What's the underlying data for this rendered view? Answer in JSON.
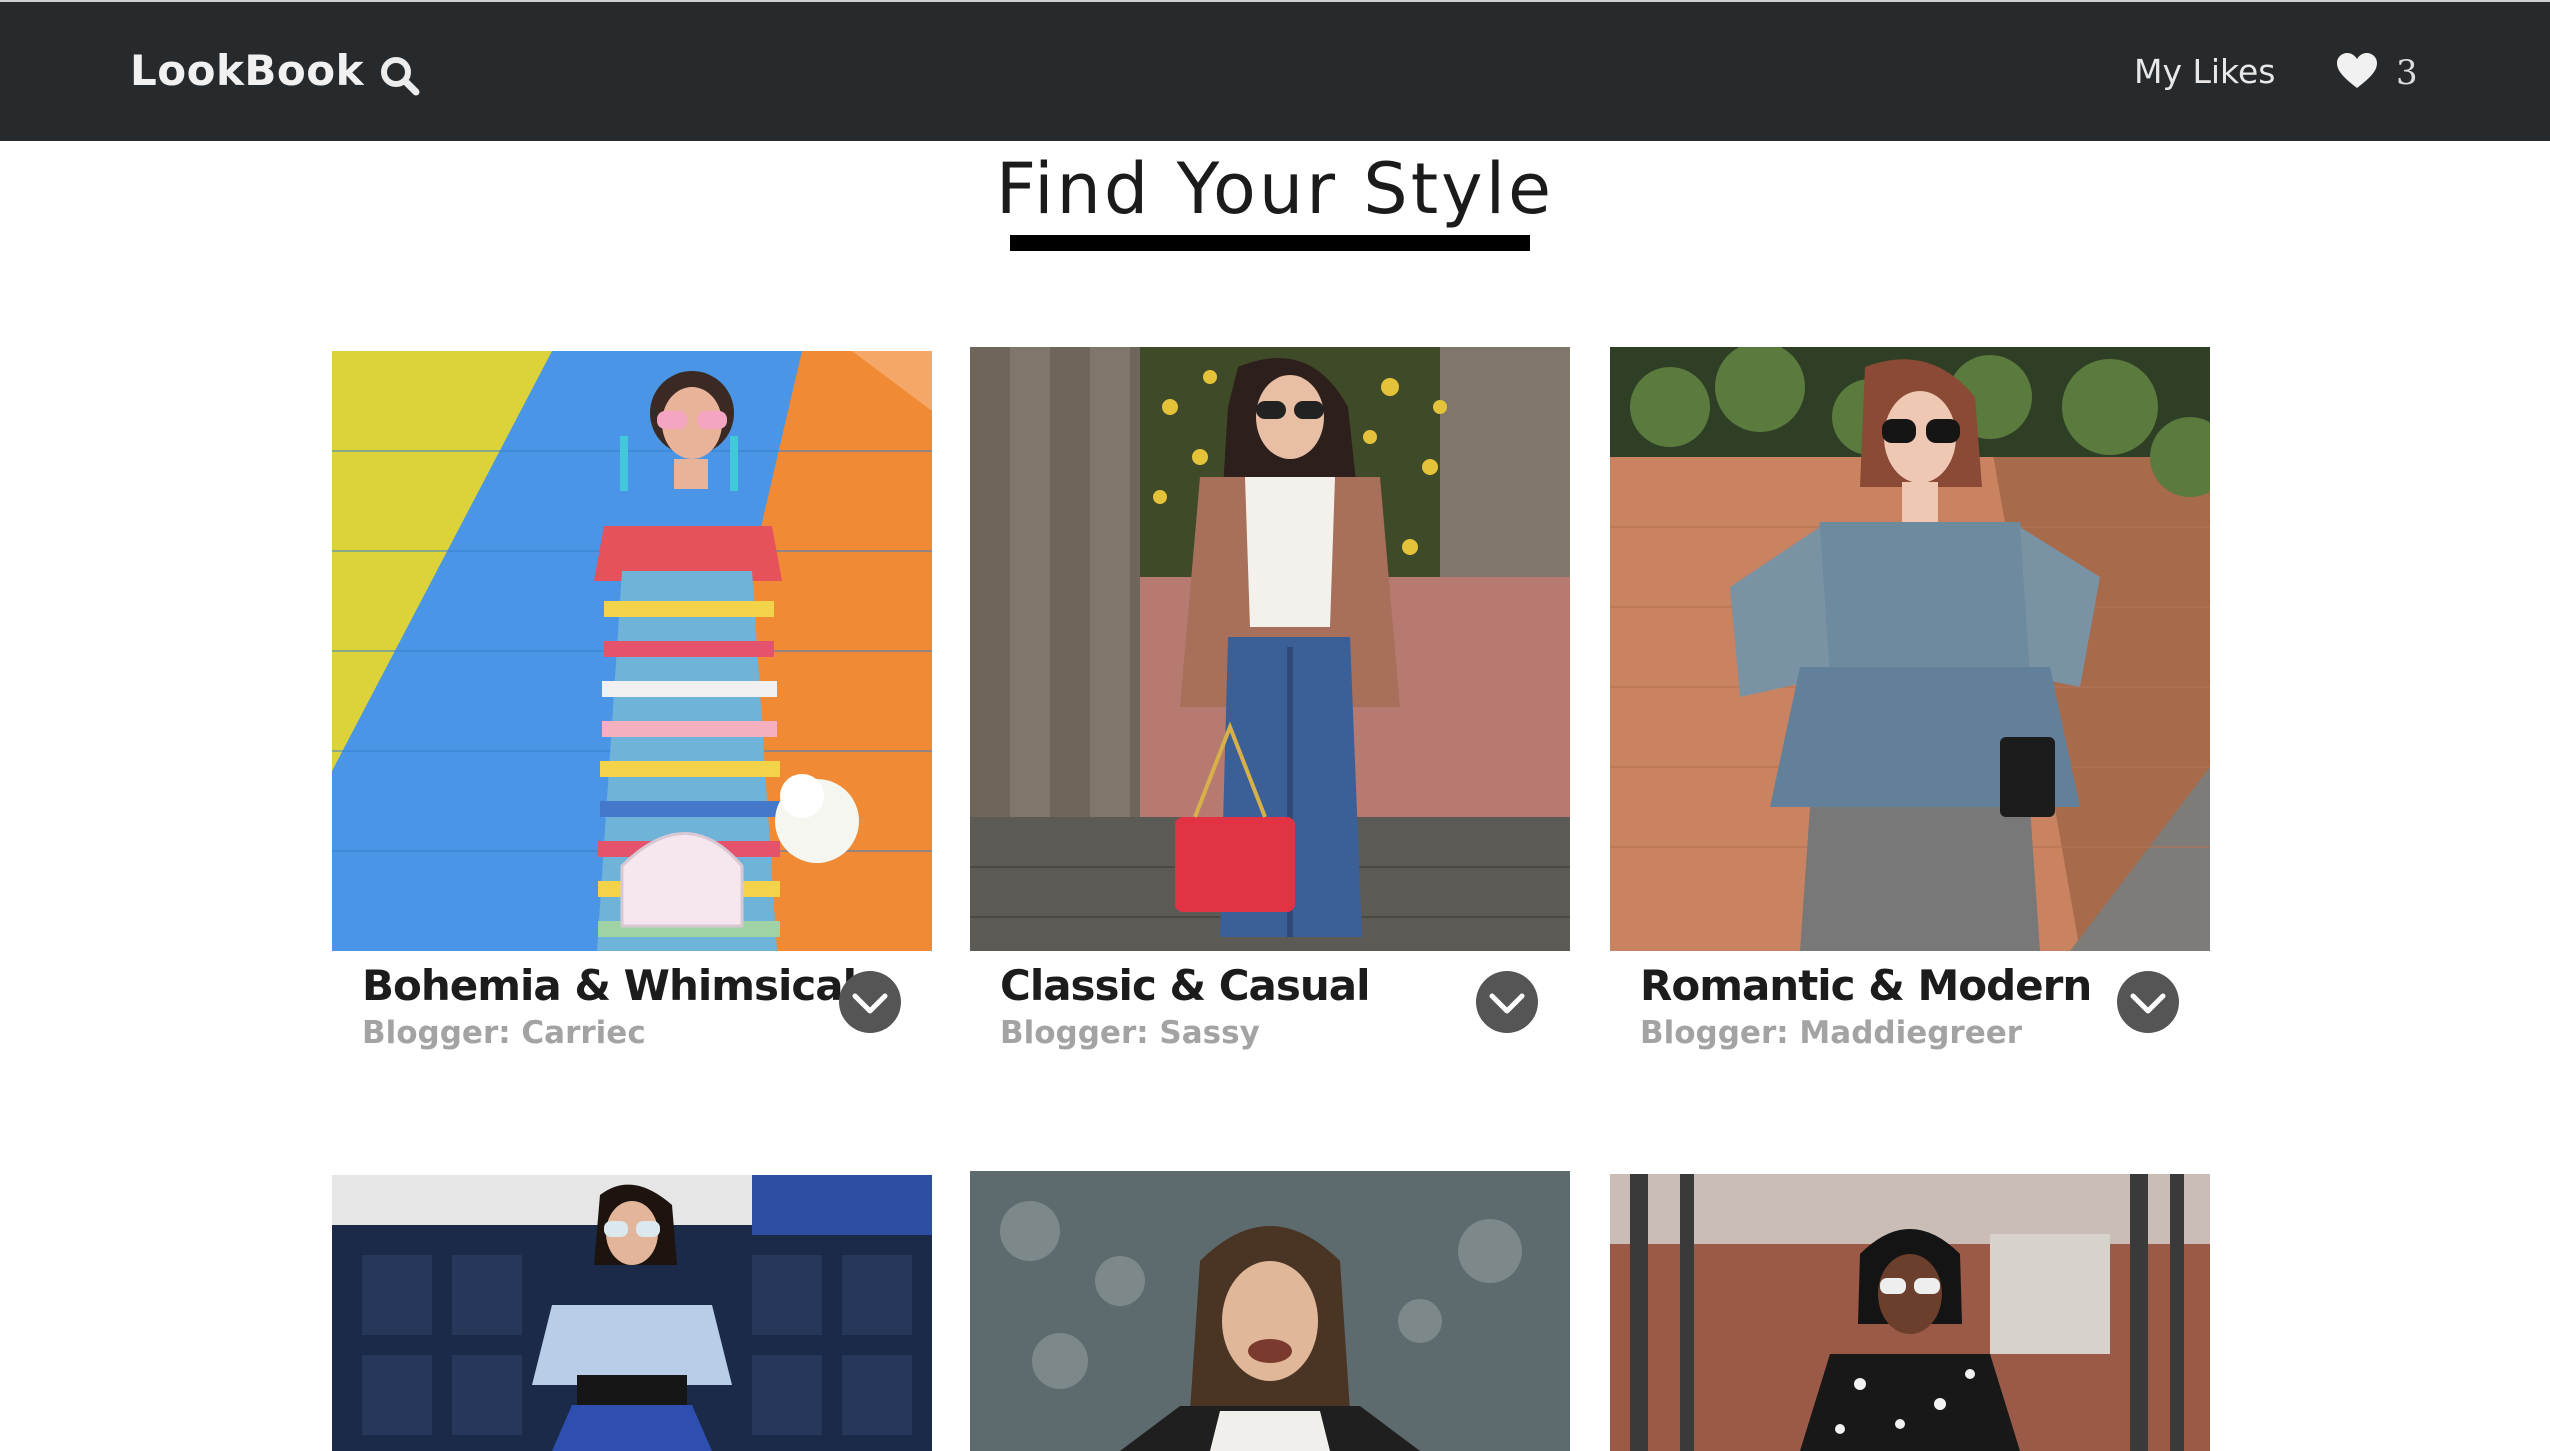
{
  "navbar": {
    "brand": "LookBook",
    "search_icon": "search-icon",
    "my_likes_label": "My Likes",
    "likes_icon": "heart-icon",
    "likes_count": "3"
  },
  "page": {
    "title": "Find Your Style"
  },
  "cards": [
    {
      "title": "Bohemia & Whimsical",
      "blogger": "Blogger: Carriec",
      "expand_icon": "chevron-down-icon"
    },
    {
      "title": "Classic & Casual",
      "blogger": "Blogger: Sassy",
      "expand_icon": "chevron-down-icon"
    },
    {
      "title": "Romantic & Modern",
      "blogger": "Blogger: Maddiegreer",
      "expand_icon": "chevron-down-icon"
    }
  ],
  "colors": {
    "navbar_bg": "#272a2d",
    "title_underline": "#000000",
    "subtitle_gray": "#a3a3a3",
    "expand_button": "#555555"
  }
}
